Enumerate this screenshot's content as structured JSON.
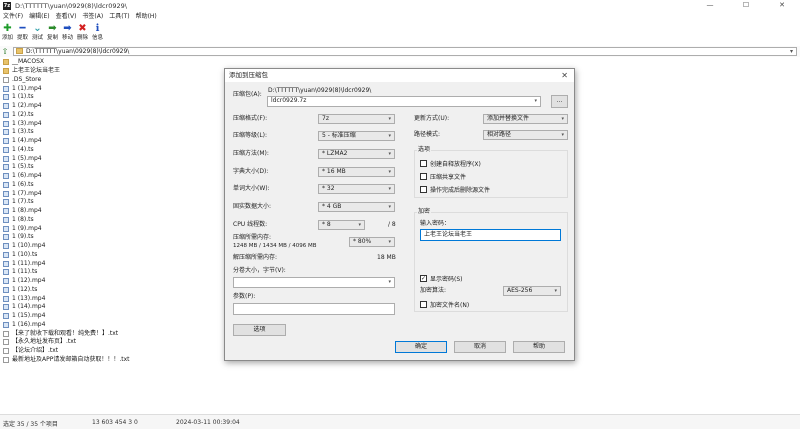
{
  "window": {
    "title": "D:\\TTTTTT\\yuan\\0929(8)\\ldcr0929\\",
    "app_icon": "7z",
    "min": "—",
    "max": "☐",
    "close": "✕"
  },
  "menu": [
    "文件(F)",
    "编辑(E)",
    "查看(V)",
    "书签(A)",
    "工具(T)",
    "帮助(H)"
  ],
  "toolbar": [
    {
      "label": "添加",
      "icon": "add-icon",
      "glyph": "✚",
      "color": "#1e9b2a"
    },
    {
      "label": "提取",
      "icon": "extract-icon",
      "glyph": "━",
      "color": "#1f4fbf"
    },
    {
      "label": "测试",
      "icon": "test-icon",
      "glyph": "⌄",
      "color": "#2a9ea7"
    },
    {
      "label": "复制",
      "icon": "copy-icon",
      "glyph": "➡",
      "color": "#2a8a2a"
    },
    {
      "label": "移动",
      "icon": "move-icon",
      "glyph": "➡",
      "color": "#1f4fbf"
    },
    {
      "label": "删除",
      "icon": "delete-icon",
      "glyph": "✖",
      "color": "#d32020"
    },
    {
      "label": "信息",
      "icon": "info-icon",
      "glyph": "ℹ",
      "color": "#1f4fbf"
    }
  ],
  "address": {
    "path": "D:\\TTTTTT\\yuan\\0929(8)\\ldcr0929\\"
  },
  "files": [
    {
      "name": "__MACOSX",
      "type": "folder"
    },
    {
      "name": "上老王论坛当老王",
      "type": "folder"
    },
    {
      "name": ".DS_Store",
      "type": "file"
    },
    {
      "name": "1 (1).mp4",
      "type": "media"
    },
    {
      "name": "1 (1).ts",
      "type": "media"
    },
    {
      "name": "1 (2).mp4",
      "type": "media"
    },
    {
      "name": "1 (2).ts",
      "type": "media"
    },
    {
      "name": "1 (3).mp4",
      "type": "media"
    },
    {
      "name": "1 (3).ts",
      "type": "media"
    },
    {
      "name": "1 (4).mp4",
      "type": "media"
    },
    {
      "name": "1 (4).ts",
      "type": "media"
    },
    {
      "name": "1 (5).mp4",
      "type": "media"
    },
    {
      "name": "1 (5).ts",
      "type": "media"
    },
    {
      "name": "1 (6).mp4",
      "type": "media"
    },
    {
      "name": "1 (6).ts",
      "type": "media"
    },
    {
      "name": "1 (7).mp4",
      "type": "media"
    },
    {
      "name": "1 (7).ts",
      "type": "media"
    },
    {
      "name": "1 (8).mp4",
      "type": "media"
    },
    {
      "name": "1 (8).ts",
      "type": "media"
    },
    {
      "name": "1 (9).mp4",
      "type": "media"
    },
    {
      "name": "1 (9).ts",
      "type": "media"
    },
    {
      "name": "1 (10).mp4",
      "type": "media"
    },
    {
      "name": "1 (10).ts",
      "type": "media"
    },
    {
      "name": "1 (11).mp4",
      "type": "media"
    },
    {
      "name": "1 (11).ts",
      "type": "media"
    },
    {
      "name": "1 (12).mp4",
      "type": "media"
    },
    {
      "name": "1 (12).ts",
      "type": "media"
    },
    {
      "name": "1 (13).mp4",
      "type": "media"
    },
    {
      "name": "1 (14).mp4",
      "type": "media"
    },
    {
      "name": "1 (15).mp4",
      "type": "media"
    },
    {
      "name": "1 (16).mp4",
      "type": "media"
    },
    {
      "name": "【来了就收下载和观看！纯免费！】.txt",
      "type": "file"
    },
    {
      "name": "【永久地址发布页】.txt",
      "type": "file"
    },
    {
      "name": "【论坛介绍】.txt",
      "type": "file"
    },
    {
      "name": "最新地址及APP请发邮箱自动获取！！！.txt",
      "type": "file"
    }
  ],
  "status": {
    "selection": "选定 35 / 35 个项目",
    "size": "13 603 454 3 0",
    "modified": "2024-03-11 00:39:04"
  },
  "dialog": {
    "title": "添加到压缩包",
    "close": "✕",
    "archive_label": "压缩包(A):",
    "archive_dir": "D:\\TTTTTT\\yuan\\0929(8)\\ldcr0929\\",
    "archive_name": "ldcr0929.7z",
    "browse": "...",
    "format_label": "压缩格式(F):",
    "format_value": "7z",
    "level_label": "压缩等级(L):",
    "level_value": "5 - 标准压缩",
    "method_label": "压缩方法(M):",
    "method_value": "* LZMA2",
    "dict_label": "字典大小(D):",
    "dict_value": "* 16 MB",
    "word_label": "单词大小(W):",
    "word_value": "* 32",
    "solid_label": "固实数据大小:",
    "solid_value": "* 4 GB",
    "threads_label": "CPU 线程数:",
    "threads_value": "* 8",
    "threads_max": "/ 8",
    "mem_label": "压缩所需内存:",
    "mem_detail": "1248 MB / 1434 MB / 4096 MB",
    "mem_value": "* 80%",
    "decomp_label": "解压缩所需内存:",
    "decomp_value": "18 MB",
    "split_label": "分卷大小，字节(V):",
    "params_label": "参数(P):",
    "options_btn": "选项",
    "update_label": "更新方式(U):",
    "update_value": "添加并替换文件",
    "pathmode_label": "路径模式:",
    "pathmode_value": "相对路径",
    "options_group": "选项",
    "opt_sfx": "创建自释放程序(X)",
    "opt_shared": "压缩共享文件",
    "opt_delete": "操作完成后删除源文件",
    "enc_group": "加密",
    "pwd_label": "输入密码：",
    "pwd_value": "上老王论坛当老王",
    "show_pwd": "显示密码(S)",
    "enc_method_label": "加密算法:",
    "enc_method_value": "AES-256",
    "enc_names": "加密文件名(N)",
    "ok": "确定",
    "cancel": "取消",
    "help": "帮助",
    "check_mark": "✓"
  }
}
